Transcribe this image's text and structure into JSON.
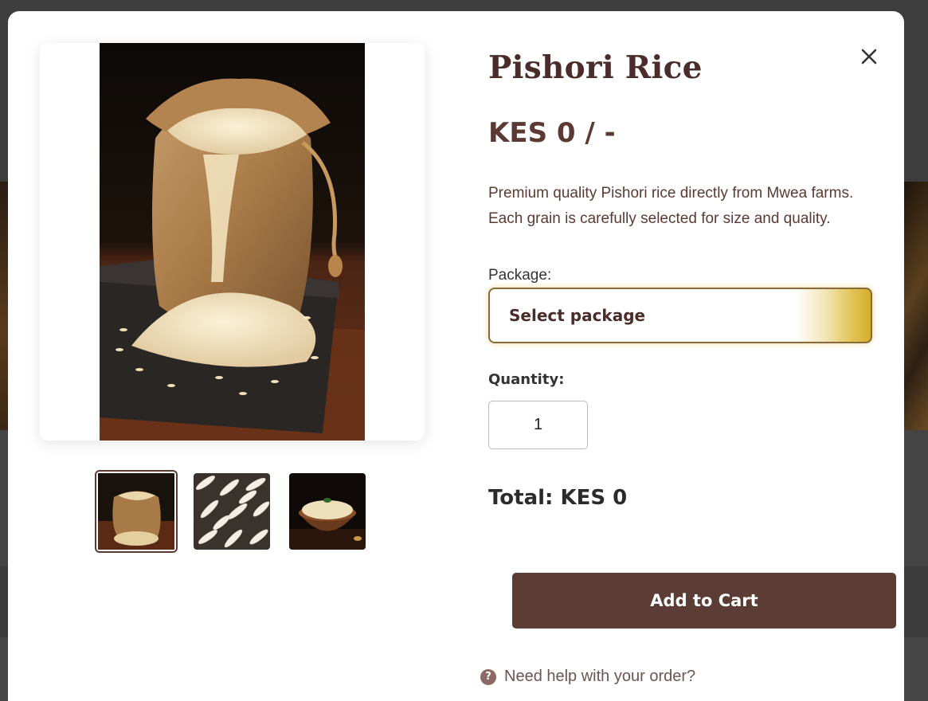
{
  "product": {
    "title": "Pishori Rice",
    "price": "KES 0 / -",
    "description": "Premium quality Pishori rice directly from Mwea farms. Each grain is carefully selected for size and quality."
  },
  "package": {
    "label": "Package:",
    "selected": "Select package"
  },
  "quantity": {
    "label": "Quantity:",
    "value": "1"
  },
  "total": "Total: KES 0",
  "actions": {
    "add_to_cart": "Add to Cart",
    "help": "Need help with your order?",
    "help_icon_glyph": "?",
    "close_glyph": "✕"
  },
  "gallery": {
    "thumbnails": [
      "rice-sack-thumb",
      "rice-grains-thumb",
      "rice-bowl-thumb"
    ],
    "selected_index": 0
  },
  "colors": {
    "brand_brown": "#5b3d36",
    "title_brown": "#4a2c2a",
    "gold_accent": "#d4ad2b"
  }
}
